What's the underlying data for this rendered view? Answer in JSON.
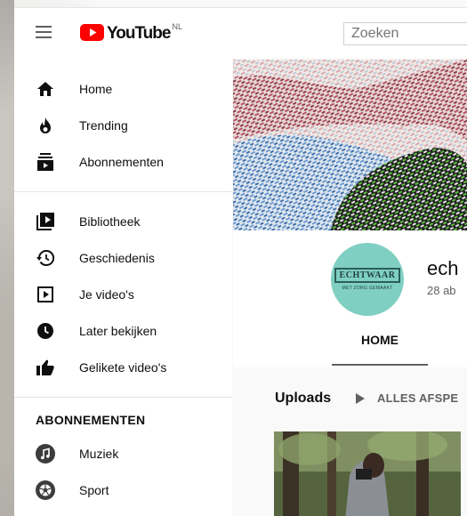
{
  "masthead": {
    "logo_text": "YouTube",
    "country_code": "NL",
    "search_placeholder": "Zoeken"
  },
  "sidebar": {
    "primary": [
      {
        "label": "Home",
        "icon": "home-icon"
      },
      {
        "label": "Trending",
        "icon": "flame-icon"
      },
      {
        "label": "Abonnementen",
        "icon": "subscriptions-icon"
      }
    ],
    "library": [
      {
        "label": "Bibliotheek",
        "icon": "library-icon"
      },
      {
        "label": "Geschiedenis",
        "icon": "history-icon"
      },
      {
        "label": "Je video's",
        "icon": "your-videos-icon"
      },
      {
        "label": "Later bekijken",
        "icon": "clock-icon"
      },
      {
        "label": "Gelikete video's",
        "icon": "thumbs-up-icon"
      }
    ],
    "subscriptions_title": "ABONNEMENTEN",
    "subscriptions": [
      {
        "label": "Muziek",
        "icon": "music-icon"
      },
      {
        "label": "Sport",
        "icon": "sport-icon"
      }
    ]
  },
  "channel": {
    "avatar_logo_text": "ECHTWAAR",
    "avatar_tagline": "MET ZORG GEMAAKT",
    "name_visible": "ech",
    "subscribers_visible": "28 ab",
    "tab_home": "HOME",
    "uploads_title": "Uploads",
    "play_all": "ALLES AFSPE"
  },
  "colors": {
    "brand_red": "#ff0000",
    "avatar_teal": "#7fcfc2",
    "icon_grey": "#606060"
  }
}
